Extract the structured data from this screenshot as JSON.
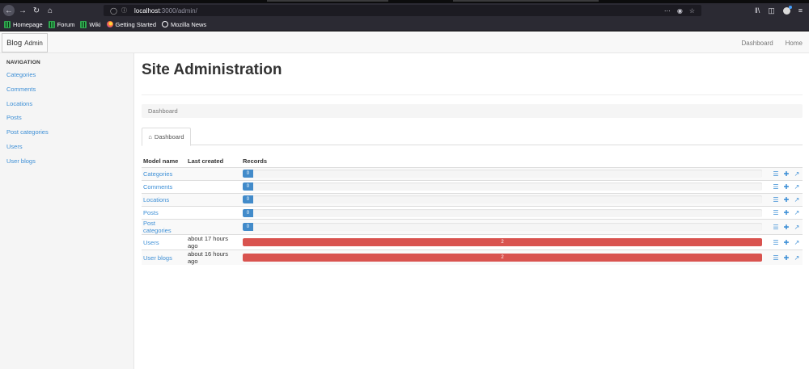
{
  "browser": {
    "url_host": "localhost",
    "url_rest": ":3000/admin/",
    "bookmarks": [
      "Homepage",
      "Forum",
      "Wiki",
      "Getting Started",
      "Mozilla News"
    ]
  },
  "nav": {
    "brand": "Blog",
    "brand_sub": "Admin",
    "links": [
      "Dashboard",
      "Home"
    ]
  },
  "sidebar": {
    "heading": "NAVIGATION",
    "items": [
      "Categories",
      "Comments",
      "Locations",
      "Posts",
      "Post categories",
      "Users",
      "User blogs"
    ]
  },
  "main": {
    "title": "Site Administration",
    "breadcrumb": "Dashboard",
    "tab": "Dashboard",
    "table": {
      "headers": [
        "Model name",
        "Last created",
        "Records"
      ],
      "rows": [
        {
          "name": "Categories",
          "last_created": "",
          "records": "0",
          "fill": 0.02,
          "color": "blue"
        },
        {
          "name": "Comments",
          "last_created": "",
          "records": "0",
          "fill": 0.02,
          "color": "blue"
        },
        {
          "name": "Locations",
          "last_created": "",
          "records": "0",
          "fill": 0.02,
          "color": "blue"
        },
        {
          "name": "Posts",
          "last_created": "",
          "records": "0",
          "fill": 0.02,
          "color": "blue"
        },
        {
          "name": "Post categories",
          "last_created": "",
          "records": "0",
          "fill": 0.02,
          "color": "blue"
        },
        {
          "name": "Users",
          "last_created": "about 17 hours ago",
          "records": "2",
          "fill": 1.0,
          "color": "red"
        },
        {
          "name": "User blogs",
          "last_created": "about 16 hours ago",
          "records": "2",
          "fill": 1.0,
          "color": "red"
        }
      ]
    }
  },
  "colors": {
    "link": "#3d8fd6",
    "bar_blue": "#428bca",
    "bar_red": "#d9534f"
  },
  "icons": [
    "back-arrow-icon",
    "forward-arrow-icon",
    "reload-icon",
    "home-icon",
    "list-icon",
    "plus-icon",
    "external-link-icon"
  ]
}
